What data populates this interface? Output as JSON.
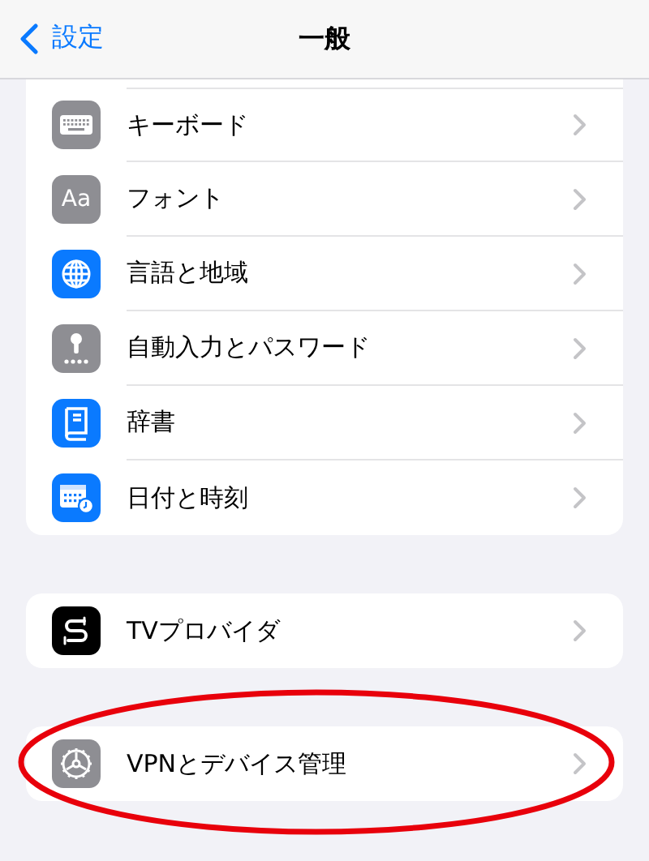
{
  "nav": {
    "back_label": "設定",
    "title": "一般"
  },
  "groups": [
    {
      "cut_top": true,
      "items": [
        {
          "kind": "keyboard",
          "label": "キーボード",
          "highlighted": false
        },
        {
          "kind": "font",
          "icon_text": "Aa",
          "label": "フォント",
          "highlighted": false
        },
        {
          "kind": "globe",
          "label": "言語と地域",
          "highlighted": false
        },
        {
          "kind": "key",
          "label": "自動入力とパスワード",
          "highlighted": false
        },
        {
          "kind": "book",
          "label": "辞書",
          "highlighted": false
        },
        {
          "kind": "calendar",
          "label": "日付と時刻",
          "highlighted": false
        }
      ]
    },
    {
      "cut_top": false,
      "items": [
        {
          "kind": "tv",
          "label": "TVプロバイダ",
          "highlighted": false
        }
      ]
    },
    {
      "cut_top": false,
      "items": [
        {
          "kind": "gear",
          "label": "VPNとデバイス管理",
          "highlighted": true
        }
      ]
    }
  ]
}
